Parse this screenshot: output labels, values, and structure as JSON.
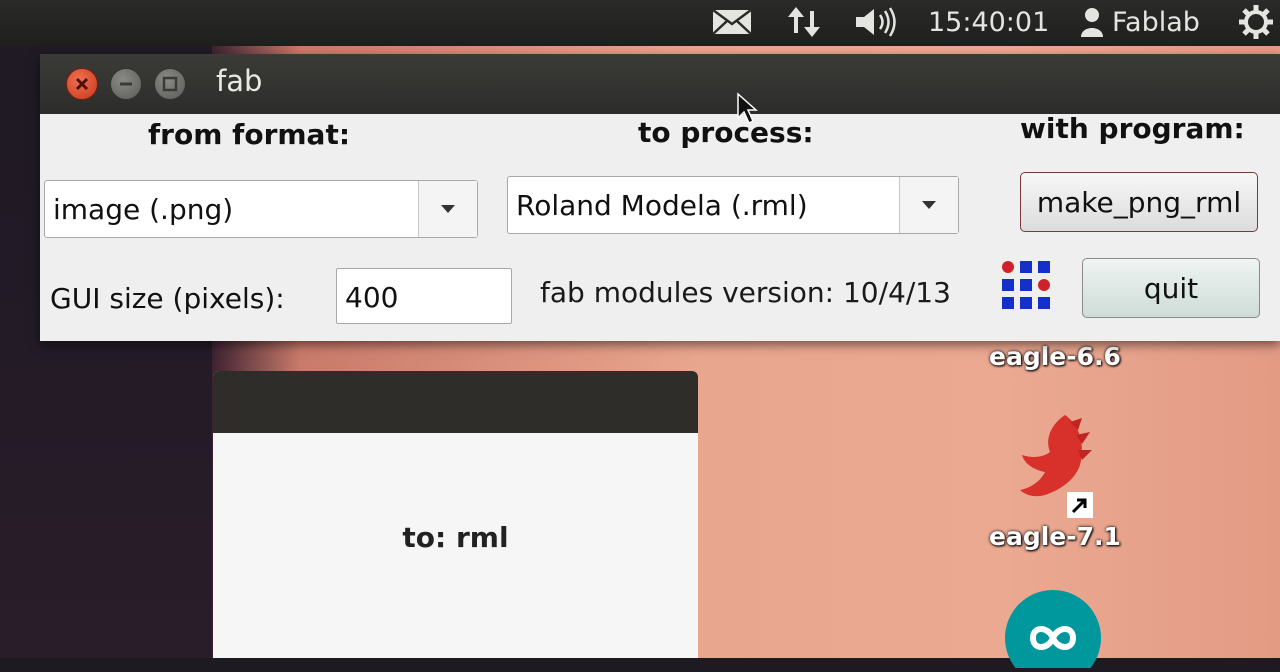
{
  "panel": {
    "clock": "15:40:01",
    "user": "Fablab",
    "icons": [
      "mail-icon",
      "network-icon",
      "volume-icon",
      "person-icon",
      "gear-icon"
    ]
  },
  "fab_window": {
    "title": "fab",
    "headers": {
      "from": "from format:",
      "process": "to process:",
      "program": "with program:"
    },
    "from_format": "image (.png)",
    "to_process": "Roland Modela (.rml)",
    "program_button": "make_png_rml",
    "gui_size_label": "GUI size (pixels):",
    "gui_size_value": "400",
    "version": "fab modules version: 10/4/13",
    "quit_button": "quit"
  },
  "rml_window": {
    "text": "to: rml"
  },
  "desktop_icons": [
    {
      "label": "eagle-6.6",
      "icon": "eagle-icon"
    },
    {
      "label": "eagle-7.1",
      "icon": "eagle-icon"
    },
    {
      "label": "",
      "icon": "arduino-icon"
    }
  ],
  "colors": {
    "close": "#d9472c",
    "panel": "#262624",
    "wallpaper": "#e9a68e",
    "grid_blue": "#1530c8",
    "grid_red": "#d2202a",
    "arduino": "#00979d"
  }
}
